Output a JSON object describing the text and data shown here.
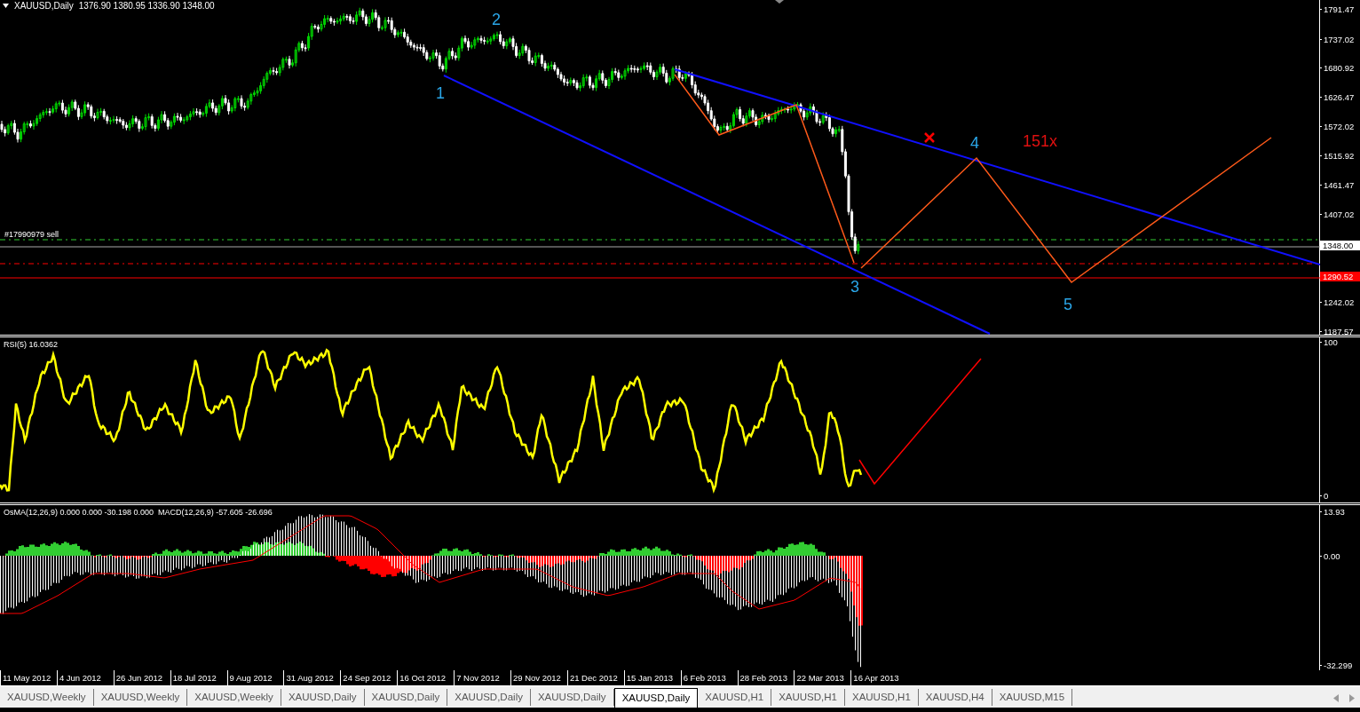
{
  "header": {
    "symbol": "XAUUSD,Daily",
    "ohlc": "1376.90 1380.95 1336.90 1348.00"
  },
  "main_pane": {
    "price_scale": [
      "1791.47",
      "1737.02",
      "1680.92",
      "1626.47",
      "1572.02",
      "1515.92",
      "1461.47",
      "1407.02",
      "1242.02",
      "1187.57"
    ],
    "price_tags": [
      {
        "text": "1348.00",
        "kind": "bid"
      },
      {
        "text": "1290.52",
        "kind": "stop"
      }
    ],
    "order_label": "#17990979 sell",
    "wave_labels": [
      "1",
      "2",
      "3",
      "4",
      "5"
    ],
    "annotation": "151x"
  },
  "rsi_pane": {
    "title": "RSI(5) 16.0362",
    "scale": [
      "100",
      "0"
    ]
  },
  "macd_pane": {
    "title": "OsMA(12,26,9) 0.000 0.000 -30.198 0.000  MACD(12,26,9) -57.605 -26.696",
    "scale": [
      "13.93",
      "0.00",
      "-32.299"
    ]
  },
  "date_axis": [
    "11 May 2012",
    "4 Jun 2012",
    "26 Jun 2012",
    "18 Jul 2012",
    "9 Aug 2012",
    "31 Aug 2012",
    "24 Sep 2012",
    "16 Oct 2012",
    "7 Nov 2012",
    "29 Nov 2012",
    "21 Dec 2012",
    "15 Jan 2013",
    "6 Feb 2013",
    "28 Feb 2013",
    "22 Mar 2013",
    "16 Apr 2013"
  ],
  "tabs": [
    {
      "label": "XAUUSD,Weekly",
      "selected": false
    },
    {
      "label": "XAUUSD,Weekly",
      "selected": false
    },
    {
      "label": "XAUUSD,Weekly",
      "selected": false
    },
    {
      "label": "XAUUSD,Daily",
      "selected": false
    },
    {
      "label": "XAUUSD,Daily",
      "selected": false
    },
    {
      "label": "XAUUSD,Daily",
      "selected": false
    },
    {
      "label": "XAUUSD,Daily",
      "selected": false
    },
    {
      "label": "XAUUSD,Daily",
      "selected": true
    },
    {
      "label": "XAUUSD,H1",
      "selected": false
    },
    {
      "label": "XAUUSD,H1",
      "selected": false
    },
    {
      "label": "XAUUSD,H1",
      "selected": false
    },
    {
      "label": "XAUUSD,H4",
      "selected": false
    },
    {
      "label": "XAUUSD,M15",
      "selected": false
    }
  ]
}
